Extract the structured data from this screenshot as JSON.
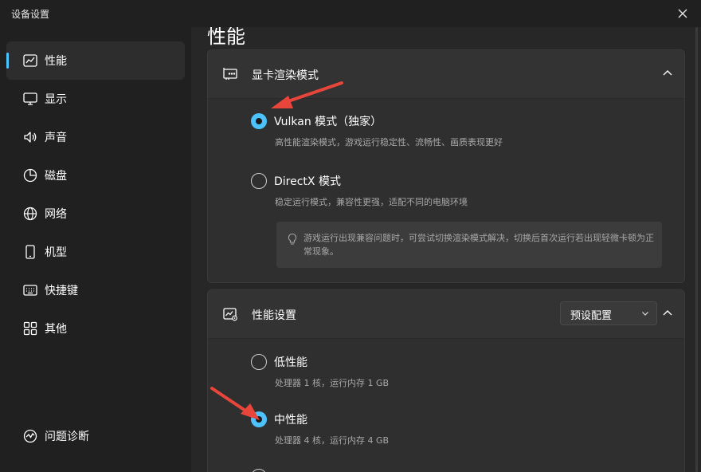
{
  "window": {
    "title": "设备设置"
  },
  "sidebar": {
    "items": [
      {
        "label": "性能",
        "icon": "performance-chart-icon",
        "active": true
      },
      {
        "label": "显示",
        "icon": "monitor-icon"
      },
      {
        "label": "声音",
        "icon": "speaker-icon"
      },
      {
        "label": "磁盘",
        "icon": "pie-chart-icon"
      },
      {
        "label": "网络",
        "icon": "globe-icon"
      },
      {
        "label": "机型",
        "icon": "phone-icon"
      },
      {
        "label": "快捷键",
        "icon": "keyboard-icon"
      },
      {
        "label": "其他",
        "icon": "grid-apps-icon"
      }
    ],
    "bottom_item": {
      "label": "问题诊断",
      "icon": "diagnostics-icon"
    }
  },
  "main": {
    "title": "性能",
    "render_card": {
      "title": "显卡渲染模式",
      "options": [
        {
          "label": "Vulkan 模式（独家）",
          "desc": "高性能渲染模式，游戏运行稳定性、流畅性、画质表现更好",
          "selected": true
        },
        {
          "label": "DirectX 模式",
          "desc": "稳定运行模式，兼容性更强，适配不同的电脑环境",
          "selected": false
        }
      ],
      "tip": "游戏运行出现兼容问题时，可尝试切换渲染模式解决，切换后首次运行若出现轻微卡顿为正常现象。"
    },
    "perf_card": {
      "title": "性能设置",
      "select_value": "预设配置",
      "options": [
        {
          "label": "低性能",
          "desc": "处理器 1 核，运行内存 1 GB",
          "selected": false
        },
        {
          "label": "中性能",
          "desc": "处理器 4 核，运行内存 4 GB",
          "selected": true
        }
      ]
    }
  },
  "colors": {
    "accent": "#4cc2ff",
    "annotation_arrow": "#e8463a"
  }
}
